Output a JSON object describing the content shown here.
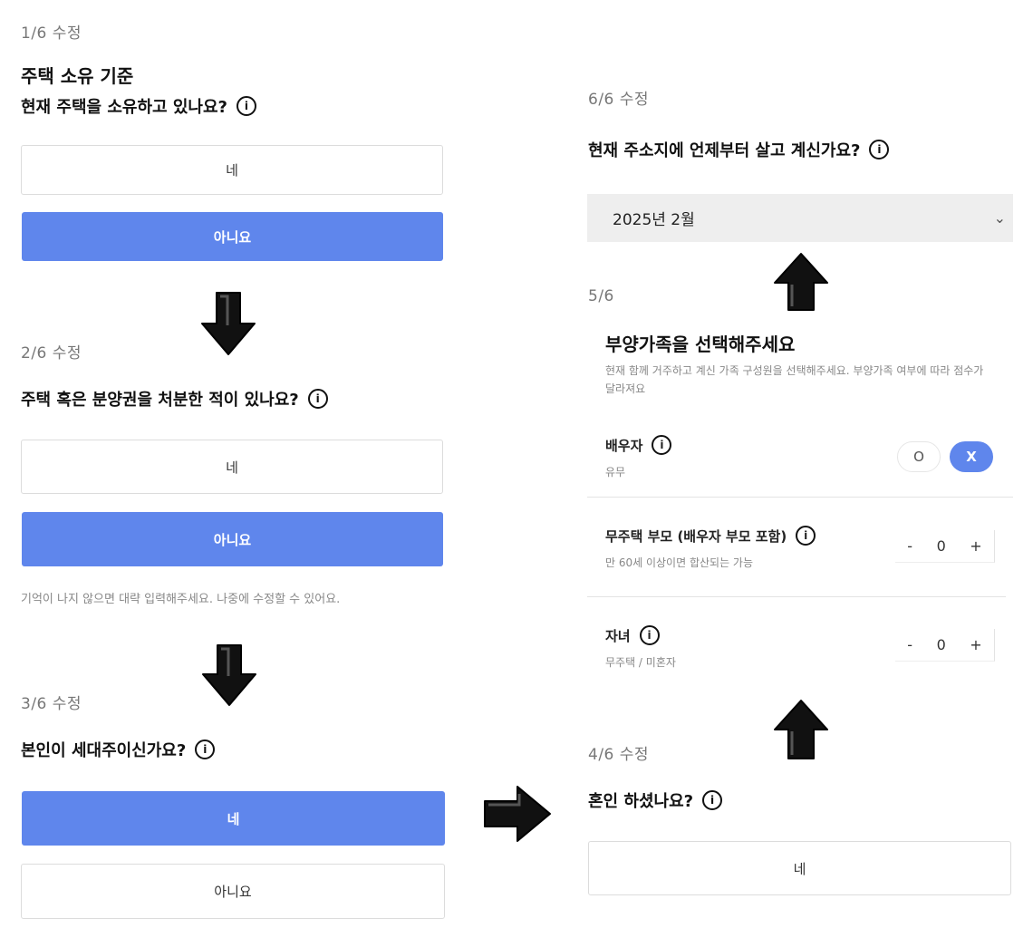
{
  "step1": {
    "progress": "1/6 수정",
    "heading": "주택 소유 기준",
    "question": "현재 주택을 소유하고 있나요?",
    "yes_label": "네",
    "no_label": "아니요",
    "selected": "no"
  },
  "step2": {
    "progress": "2/6 수정",
    "question": "주택 혹은 분양권을 처분한 적이 있나요?",
    "yes_label": "네",
    "no_label": "아니요",
    "selected": "no",
    "helper": "기억이 나지 않으면 대략 입력해주세요. 나중에 수정할 수 있어요."
  },
  "step3": {
    "progress": "3/6 수정",
    "question": "본인이 세대주이신가요?",
    "yes_label": "네",
    "no_label": "아니요",
    "selected": "yes"
  },
  "step4": {
    "progress": "4/6 수정",
    "question": "혼인 하셨나요?",
    "yes_label": "네"
  },
  "step5": {
    "progress": "5/6",
    "heading": "부양가족을 선택해주세요",
    "description": "현재 함께 거주하고 계신 가족 구성원을 선택해주세요. 부양가족 여부에 따라 점수가 달라져요",
    "spouse": {
      "label": "배우자",
      "sub": "유무",
      "off_label": "O",
      "on_label": "X",
      "selected": "X"
    },
    "parents": {
      "label": "무주택 부모 (배우자 부모 포함)",
      "sub": "만 60세 이상이면 합산되는 가능",
      "minus": "-",
      "value": "0",
      "plus": "+"
    },
    "children": {
      "label": "자녀",
      "sub": "무주택 / 미혼자",
      "minus": "-",
      "value": "0",
      "plus": "+"
    }
  },
  "step6": {
    "progress": "6/6 수정",
    "question": "현재 주소지에 언제부터 살고 계신가요?",
    "date_value": "2025년 2월",
    "chevron": "⌄"
  },
  "info_glyph": "i",
  "colors": {
    "primary": "#5f86ec",
    "arrow": "#111111"
  },
  "icons": {
    "info": "info-icon",
    "arrow": "arrow-icon",
    "chevron": "chevron-down-icon"
  }
}
